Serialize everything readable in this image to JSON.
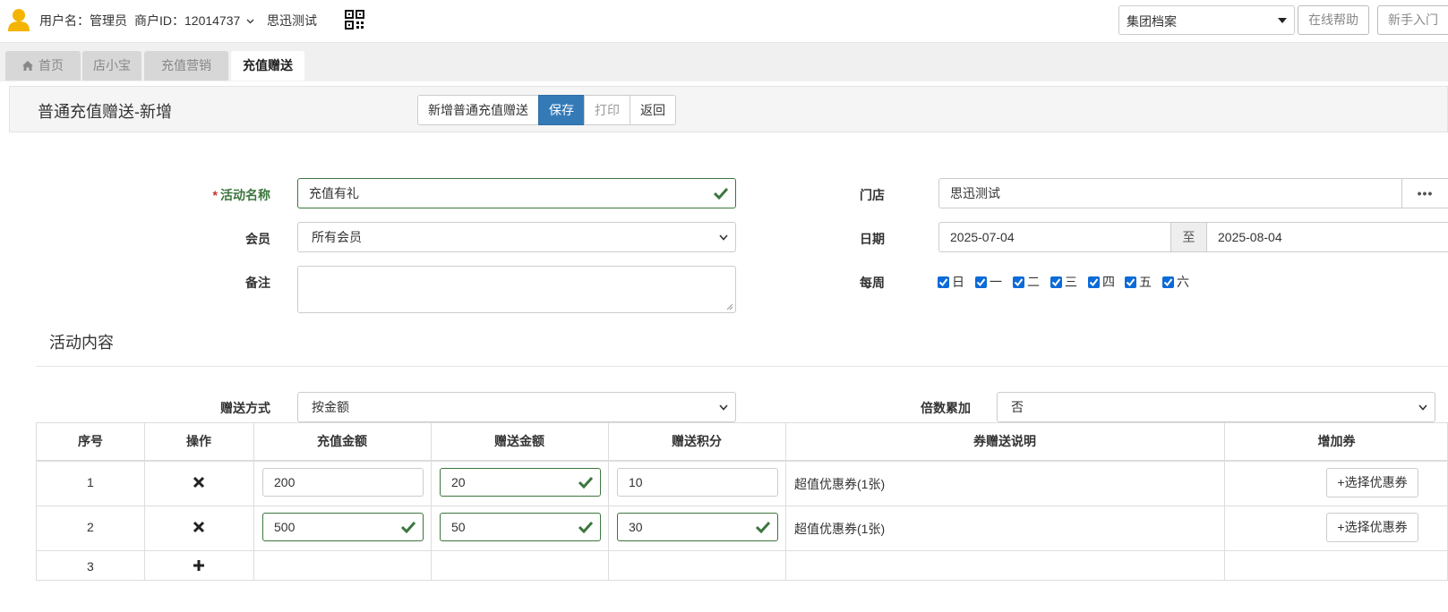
{
  "topbar": {
    "username": "用户名：管理员",
    "merchant_id": "商户ID：12014737",
    "store": "思迅测试",
    "group_select": "集团档案",
    "help_button": "在线帮助",
    "newbie_button": "新手入门"
  },
  "tabs": [
    {
      "label": "首页",
      "icon": "home-icon"
    },
    {
      "label": "店小宝"
    },
    {
      "label": "充值营销"
    },
    {
      "label": "充值赠送",
      "active": true
    }
  ],
  "header": {
    "title": "普通充值赠送-新增",
    "buttons": {
      "new": "新增普通充值赠送",
      "save": "保存",
      "print": "打印",
      "back": "返回"
    }
  },
  "form": {
    "activity_name_label": "活动名称",
    "activity_name_value": "充值有礼",
    "member_label": "会员",
    "member_value": "所有会员",
    "remark_label": "备注",
    "remark_value": "",
    "store_label": "门店",
    "store_value": "思迅测试",
    "store_more": "•••",
    "date_label": "日期",
    "date_from": "2025-07-04",
    "date_to_sep": "至",
    "date_to": "2025-08-04",
    "week_label": "每周",
    "week_days": [
      "日",
      "一",
      "二",
      "三",
      "四",
      "五",
      "六"
    ]
  },
  "content": {
    "section_title": "活动内容",
    "gift_mode_label": "赠送方式",
    "gift_mode_value": "按金额",
    "multiple_label": "倍数累加",
    "multiple_value": "否"
  },
  "table": {
    "headers": [
      "序号",
      "操作",
      "充值金额",
      "赠送金额",
      "赠送积分",
      "券赠送说明",
      "增加券"
    ],
    "rows": [
      {
        "no": "1",
        "recharge": "200",
        "gift_amount": "20",
        "points": "10",
        "coupon_desc": "超值优惠券(1张)",
        "coupon_btn": "+选择优惠券"
      },
      {
        "no": "2",
        "recharge": "500",
        "gift_amount": "50",
        "points": "30",
        "coupon_desc": "超值优惠券(1张)",
        "coupon_btn": "+选择优惠券"
      },
      {
        "no": "3"
      }
    ]
  },
  "colors": {
    "primary": "#337ab7",
    "success": "#3c763d",
    "checkbox": "#0b6bd7"
  }
}
